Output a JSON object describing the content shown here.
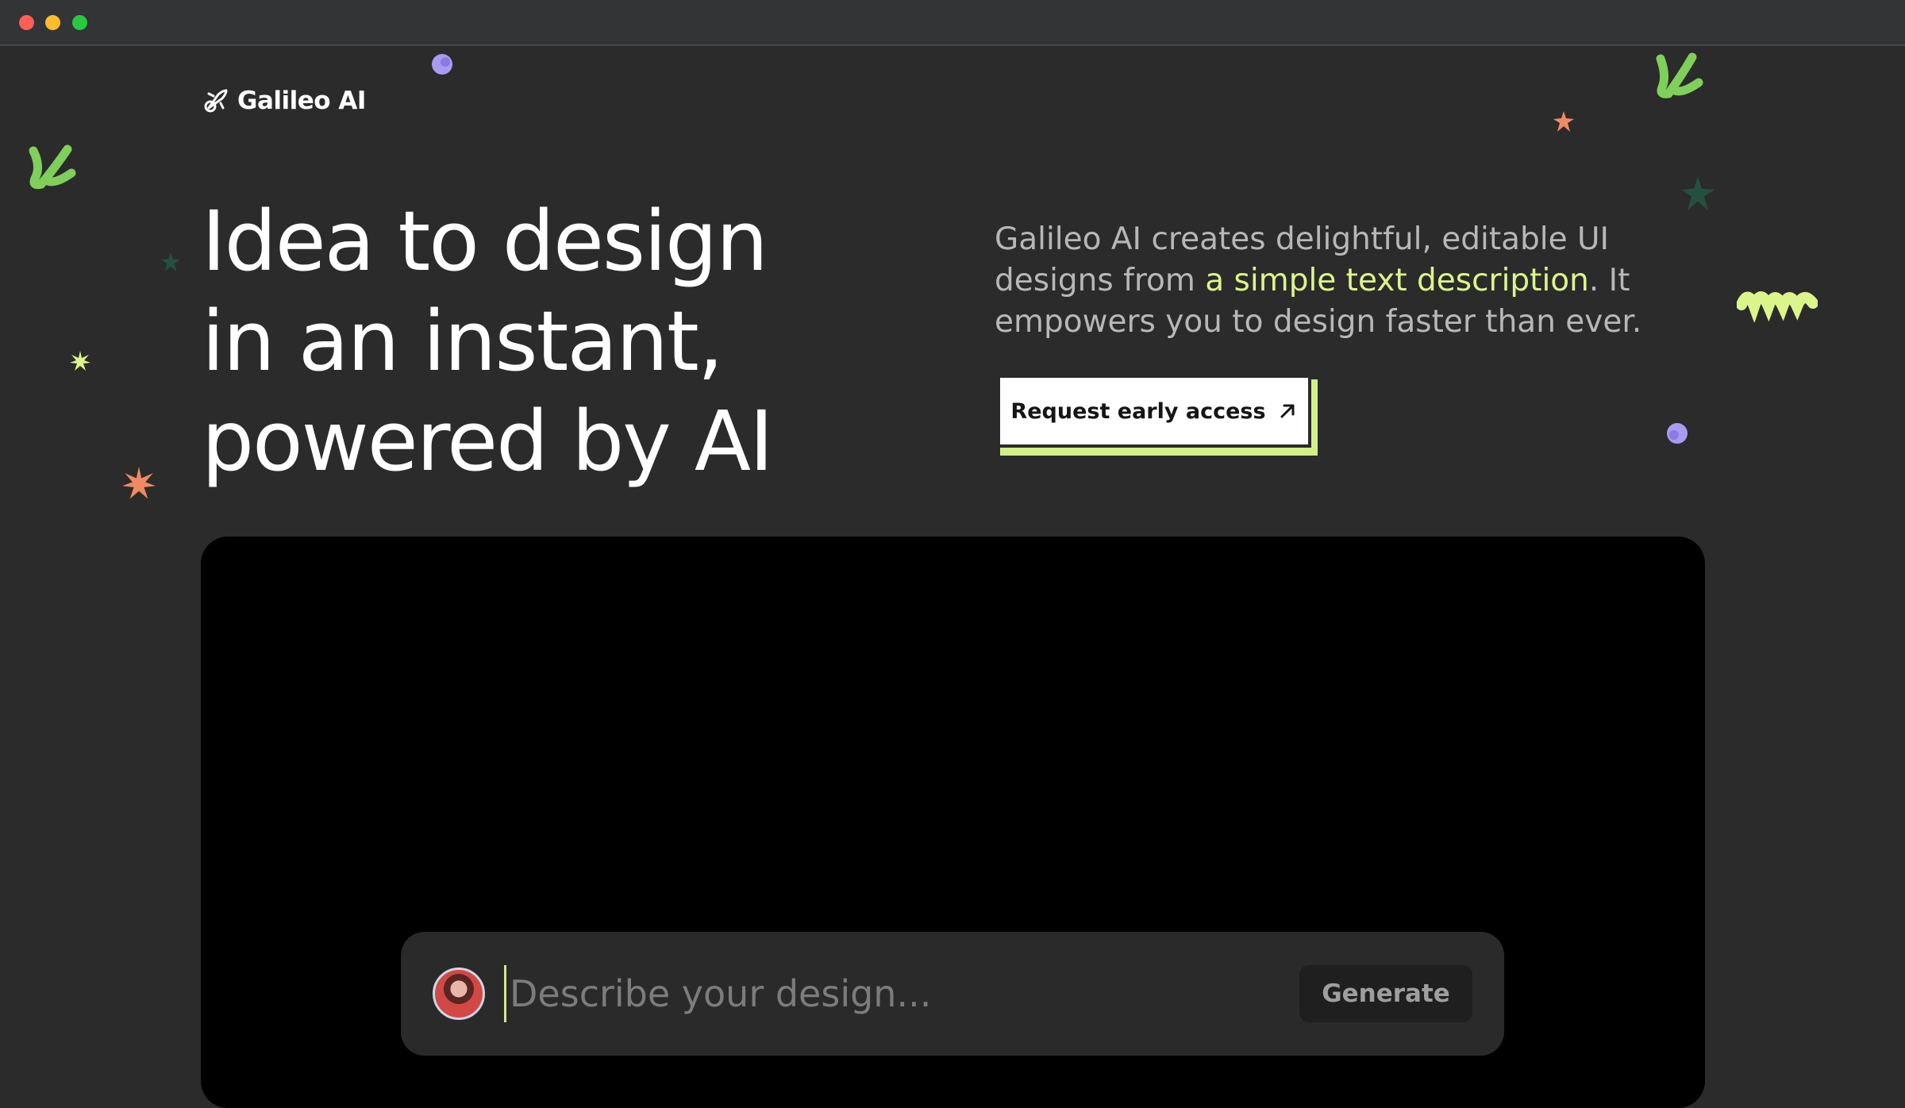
{
  "window": {
    "controls": [
      "close",
      "minimize",
      "maximize"
    ]
  },
  "brand": {
    "name": "Galileo AI",
    "icon": "rocket-icon"
  },
  "hero": {
    "headline_lines": [
      "Idea to design",
      "in an instant,",
      "powered by AI"
    ],
    "description_before": "Galileo AI creates delightful, editable UI designs from ",
    "description_highlight": "a simple text description",
    "description_after": ". It empowers you to design faster than ever.",
    "cta_label": "Request early access",
    "cta_icon": "arrow-up-right-icon"
  },
  "prompt_bar": {
    "placeholder": "Describe your design...",
    "value": "",
    "generate_label": "Generate",
    "avatar": "user-avatar"
  },
  "colors": {
    "background": "#2b2b2b",
    "accent_lime": "#dcf58a",
    "accent_green": "#7fcf5a",
    "accent_purple": "#a99af2",
    "accent_orange": "#f08a63",
    "dark_green": "#24503f"
  }
}
